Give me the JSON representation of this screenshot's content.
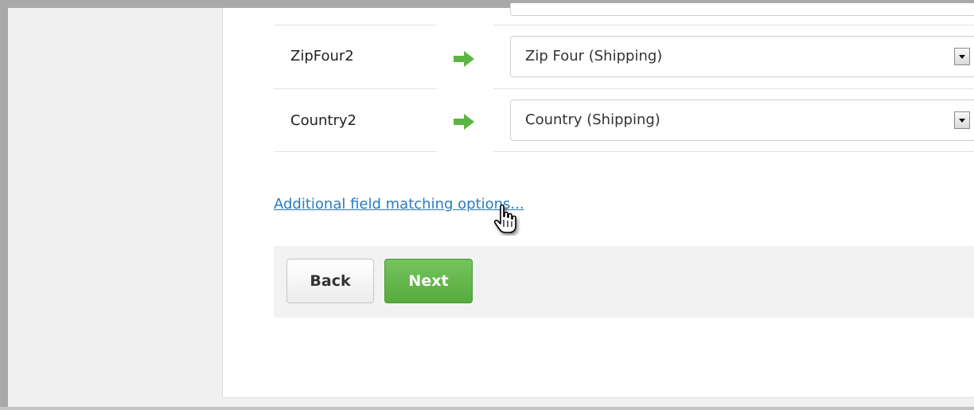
{
  "rows": [
    {
      "source": "ZipFour2",
      "target": "Zip Four (Shipping)"
    },
    {
      "source": "Country2",
      "target": "Country (Shipping)"
    }
  ],
  "link": {
    "label": "Additional field matching options..."
  },
  "buttons": {
    "back": "Back",
    "next": "Next"
  },
  "icons": {
    "arrow": "green-right-arrow-icon",
    "cursor": "hand-pointer-icon",
    "dropdown": "dropdown-arrow-icon"
  },
  "colors": {
    "arrow": "#5bb543",
    "link": "#2a7bbf",
    "next_button": "#5cb543"
  }
}
